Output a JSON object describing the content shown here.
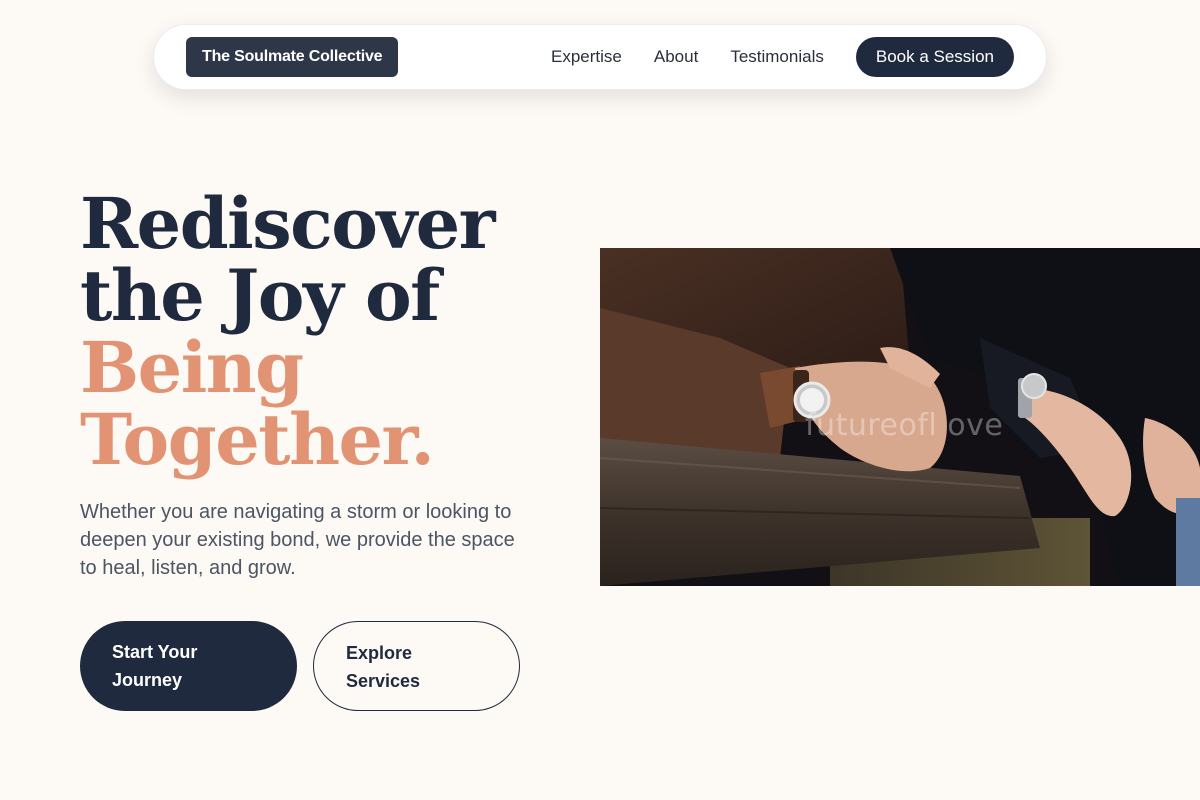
{
  "navbar": {
    "brand": "The Soulmate Collective",
    "links": [
      "Expertise",
      "About",
      "Testimonials"
    ],
    "cta": "Book a Session"
  },
  "hero": {
    "headline_line1": "Rediscover",
    "headline_line2": "the Joy of",
    "headline_line3": "Being",
    "headline_line4": "Together.",
    "subtext": "Whether you are navigating a storm or looking to deepen your existing bond, we provide the space to heal, listen, and grow.",
    "primary_cta": "Start Your Journey",
    "secondary_cta": "Explore Services"
  },
  "photo": {
    "watermark": "futureofl ove"
  },
  "colors": {
    "navy": "#1f2a3e",
    "accent": "#e29373",
    "background": "#fdf9f5"
  }
}
